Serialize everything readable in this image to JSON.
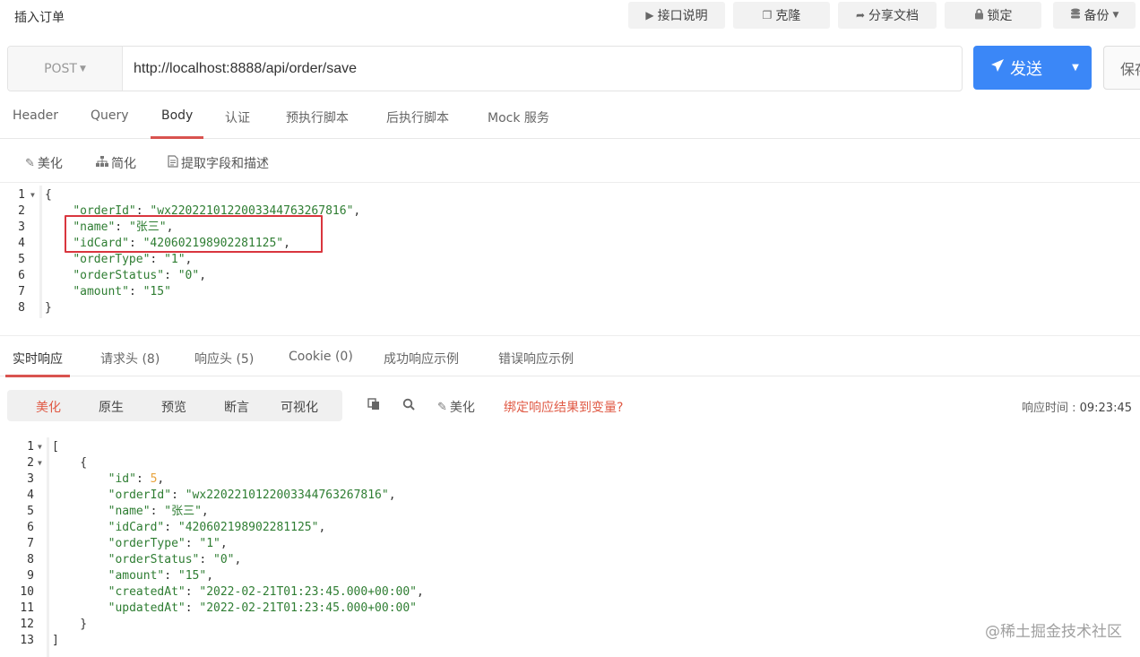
{
  "window": {
    "title": "插入订单"
  },
  "toolbar": {
    "api_doc": "接口说明",
    "clone": "克隆",
    "share_doc": "分享文档",
    "lock": "锁定",
    "backup": "备份"
  },
  "request": {
    "method": "POST",
    "url": "http://localhost:8888/api/order/save",
    "send_label": "发送",
    "save_label": "保存"
  },
  "request_tabs": [
    "Header",
    "Query",
    "Body",
    "认证",
    "预执行脚本",
    "后执行脚本",
    "Mock 服务"
  ],
  "request_tabs_active": "Body",
  "body_toolbar": {
    "beautify": "美化",
    "simplify": "简化",
    "extract": "提取字段和描述"
  },
  "request_body_lines": [
    [
      [
        "p",
        "{"
      ]
    ],
    [
      [
        "p",
        "    "
      ],
      [
        "k",
        "\"orderId\""
      ],
      [
        "p",
        ": "
      ],
      [
        "s",
        "\"wx2202210122003344763267816\""
      ],
      [
        "p",
        ","
      ]
    ],
    [
      [
        "p",
        "    "
      ],
      [
        "k",
        "\"name\""
      ],
      [
        "p",
        ": "
      ],
      [
        "s",
        "\"张三\""
      ],
      [
        "p",
        ","
      ]
    ],
    [
      [
        "p",
        "    "
      ],
      [
        "k",
        "\"idCard\""
      ],
      [
        "p",
        ": "
      ],
      [
        "s",
        "\"420602198902281125\""
      ],
      [
        "p",
        ","
      ]
    ],
    [
      [
        "p",
        "    "
      ],
      [
        "k",
        "\"orderType\""
      ],
      [
        "p",
        ": "
      ],
      [
        "s",
        "\"1\""
      ],
      [
        "p",
        ","
      ]
    ],
    [
      [
        "p",
        "    "
      ],
      [
        "k",
        "\"orderStatus\""
      ],
      [
        "p",
        ": "
      ],
      [
        "s",
        "\"0\""
      ],
      [
        "p",
        ","
      ]
    ],
    [
      [
        "p",
        "    "
      ],
      [
        "k",
        "\"amount\""
      ],
      [
        "p",
        ": "
      ],
      [
        "s",
        "\"15\""
      ]
    ],
    [
      [
        "p",
        "}"
      ]
    ]
  ],
  "response_tabs": [
    "实时响应",
    "请求头 (8)",
    "响应头 (5)",
    "Cookie (0)",
    "成功响应示例",
    "错误响应示例"
  ],
  "response_tabs_active": "实时响应",
  "response_views": [
    "美化",
    "原生",
    "预览",
    "断言",
    "可视化"
  ],
  "response_views_active": "美化",
  "response_tools": {
    "beautify": "美化",
    "bind_var": "绑定响应结果到变量?"
  },
  "response_time": {
    "label": "响应时间 :",
    "value": "09:23:45"
  },
  "response_body_lines": [
    [
      [
        "p",
        "["
      ]
    ],
    [
      [
        "p",
        "    {"
      ]
    ],
    [
      [
        "p",
        "        "
      ],
      [
        "k",
        "\"id\""
      ],
      [
        "p",
        ": "
      ],
      [
        "n",
        "5"
      ],
      [
        "p",
        ","
      ]
    ],
    [
      [
        "p",
        "        "
      ],
      [
        "k",
        "\"orderId\""
      ],
      [
        "p",
        ": "
      ],
      [
        "s",
        "\"wx2202210122003344763267816\""
      ],
      [
        "p",
        ","
      ]
    ],
    [
      [
        "p",
        "        "
      ],
      [
        "k",
        "\"name\""
      ],
      [
        "p",
        ": "
      ],
      [
        "s",
        "\"张三\""
      ],
      [
        "p",
        ","
      ]
    ],
    [
      [
        "p",
        "        "
      ],
      [
        "k",
        "\"idCard\""
      ],
      [
        "p",
        ": "
      ],
      [
        "s",
        "\"420602198902281125\""
      ],
      [
        "p",
        ","
      ]
    ],
    [
      [
        "p",
        "        "
      ],
      [
        "k",
        "\"orderType\""
      ],
      [
        "p",
        ": "
      ],
      [
        "s",
        "\"1\""
      ],
      [
        "p",
        ","
      ]
    ],
    [
      [
        "p",
        "        "
      ],
      [
        "k",
        "\"orderStatus\""
      ],
      [
        "p",
        ": "
      ],
      [
        "s",
        "\"0\""
      ],
      [
        "p",
        ","
      ]
    ],
    [
      [
        "p",
        "        "
      ],
      [
        "k",
        "\"amount\""
      ],
      [
        "p",
        ": "
      ],
      [
        "s",
        "\"15\""
      ],
      [
        "p",
        ","
      ]
    ],
    [
      [
        "p",
        "        "
      ],
      [
        "k",
        "\"createdAt\""
      ],
      [
        "p",
        ": "
      ],
      [
        "s",
        "\"2022-02-21T01:23:45.000+00:00\""
      ],
      [
        "p",
        ","
      ]
    ],
    [
      [
        "p",
        "        "
      ],
      [
        "k",
        "\"updatedAt\""
      ],
      [
        "p",
        ": "
      ],
      [
        "s",
        "\"2022-02-21T01:23:45.000+00:00\""
      ]
    ],
    [
      [
        "p",
        "    }"
      ]
    ],
    [
      [
        "p",
        "]"
      ]
    ]
  ],
  "watermark": "@稀土掘金技术社区",
  "colors": {
    "accent": "#3b87f7",
    "active_tab": "#d9534f",
    "highlight_box": "#d9363e",
    "json_key": "#2e7d32",
    "json_number": "#e8a33d",
    "link": "#e05a45"
  }
}
